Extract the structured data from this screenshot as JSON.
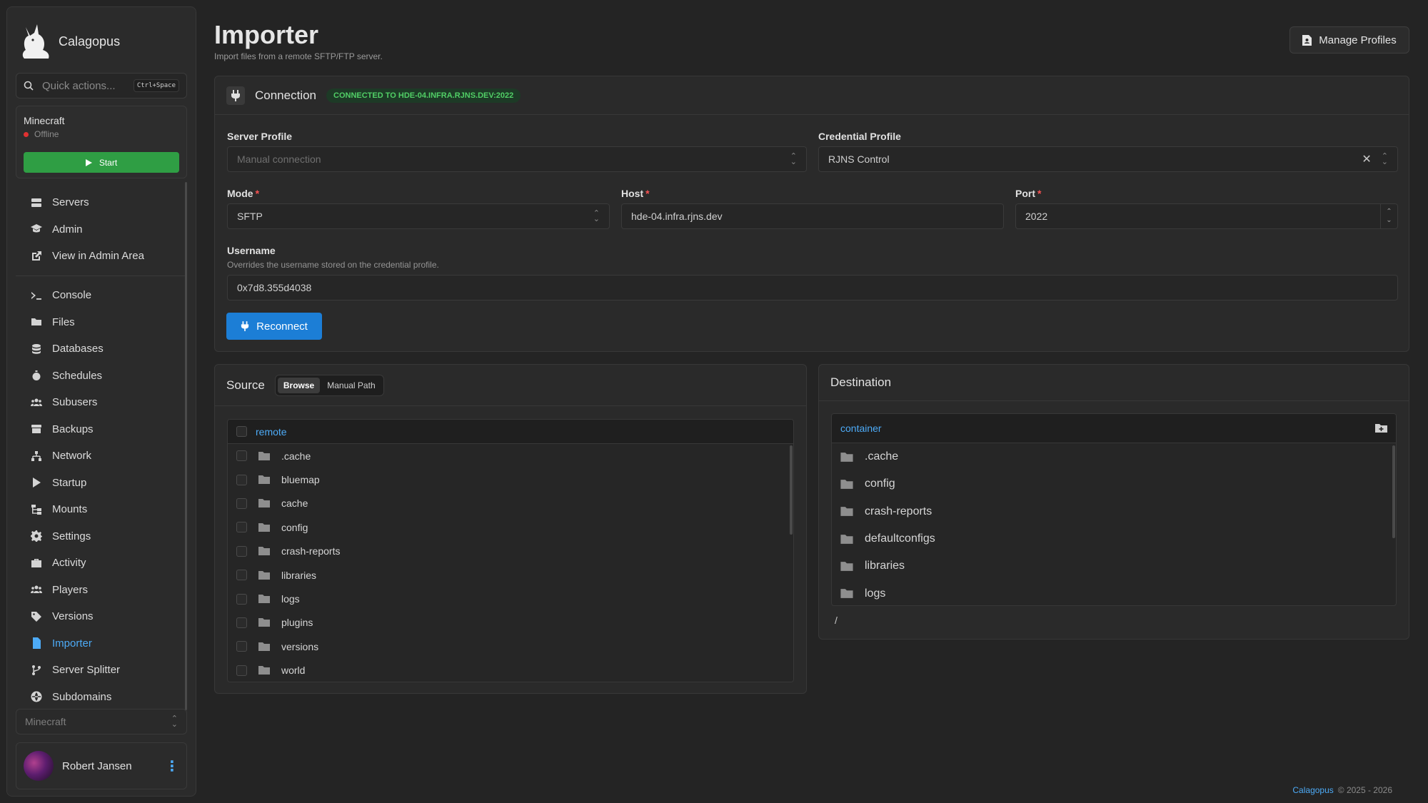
{
  "brand": {
    "name": "Calagopus"
  },
  "quick_actions": {
    "placeholder": "Quick actions...",
    "shortcut": "Ctrl+Space"
  },
  "server_card": {
    "name": "Minecraft",
    "status": "Offline",
    "start_label": "Start"
  },
  "nav_top": [
    {
      "label": "Servers",
      "icon": "servers-icon"
    },
    {
      "label": "Admin",
      "icon": "admin-icon"
    },
    {
      "label": "View in Admin Area",
      "icon": "external-link-icon"
    }
  ],
  "nav_main": [
    {
      "label": "Console",
      "icon": "console-icon"
    },
    {
      "label": "Files",
      "icon": "folder-icon"
    },
    {
      "label": "Databases",
      "icon": "database-icon"
    },
    {
      "label": "Schedules",
      "icon": "stopwatch-icon"
    },
    {
      "label": "Subusers",
      "icon": "users-icon"
    },
    {
      "label": "Backups",
      "icon": "archive-icon"
    },
    {
      "label": "Network",
      "icon": "network-icon"
    },
    {
      "label": "Startup",
      "icon": "play-icon"
    },
    {
      "label": "Mounts",
      "icon": "mounts-icon"
    },
    {
      "label": "Settings",
      "icon": "gear-icon"
    },
    {
      "label": "Activity",
      "icon": "briefcase-icon"
    },
    {
      "label": "Players",
      "icon": "players-icon"
    },
    {
      "label": "Versions",
      "icon": "tag-icon"
    },
    {
      "label": "Importer",
      "icon": "file-import-icon",
      "active": true
    },
    {
      "label": "Server Splitter",
      "icon": "branch-icon"
    },
    {
      "label": "Subdomains",
      "icon": "globe-icon"
    }
  ],
  "server_select": {
    "value": "Minecraft"
  },
  "user": {
    "name": "Robert Jansen"
  },
  "page": {
    "title": "Importer",
    "subtitle": "Import files from a remote SFTP/FTP server.",
    "manage_profiles_label": "Manage Profiles"
  },
  "connection": {
    "title": "Connection",
    "badge": "CONNECTED TO HDE-04.INFRA.RJNS.DEV:2022",
    "server_profile": {
      "label": "Server Profile",
      "placeholder": "Manual connection"
    },
    "credential_profile": {
      "label": "Credential Profile",
      "value": "RJNS Control"
    },
    "mode": {
      "label": "Mode",
      "value": "SFTP"
    },
    "host": {
      "label": "Host",
      "value": "hde-04.infra.rjns.dev"
    },
    "port": {
      "label": "Port",
      "value": "2022"
    },
    "username": {
      "label": "Username",
      "hint": "Overrides the username stored on the credential profile.",
      "value": "0x7d8.355d4038"
    },
    "reconnect_label": "Reconnect"
  },
  "source": {
    "title": "Source",
    "tabs": [
      "Browse",
      "Manual Path"
    ],
    "root": "remote",
    "items": [
      ".cache",
      "bluemap",
      "cache",
      "config",
      "crash-reports",
      "libraries",
      "logs",
      "plugins",
      "versions",
      "world"
    ]
  },
  "destination": {
    "title": "Destination",
    "root": "container",
    "items": [
      ".cache",
      "config",
      "crash-reports",
      "defaultconfigs",
      "libraries",
      "logs"
    ],
    "path": "/"
  },
  "footer": {
    "brand": "Calagopus",
    "copyright": "© 2025 - 2026"
  }
}
